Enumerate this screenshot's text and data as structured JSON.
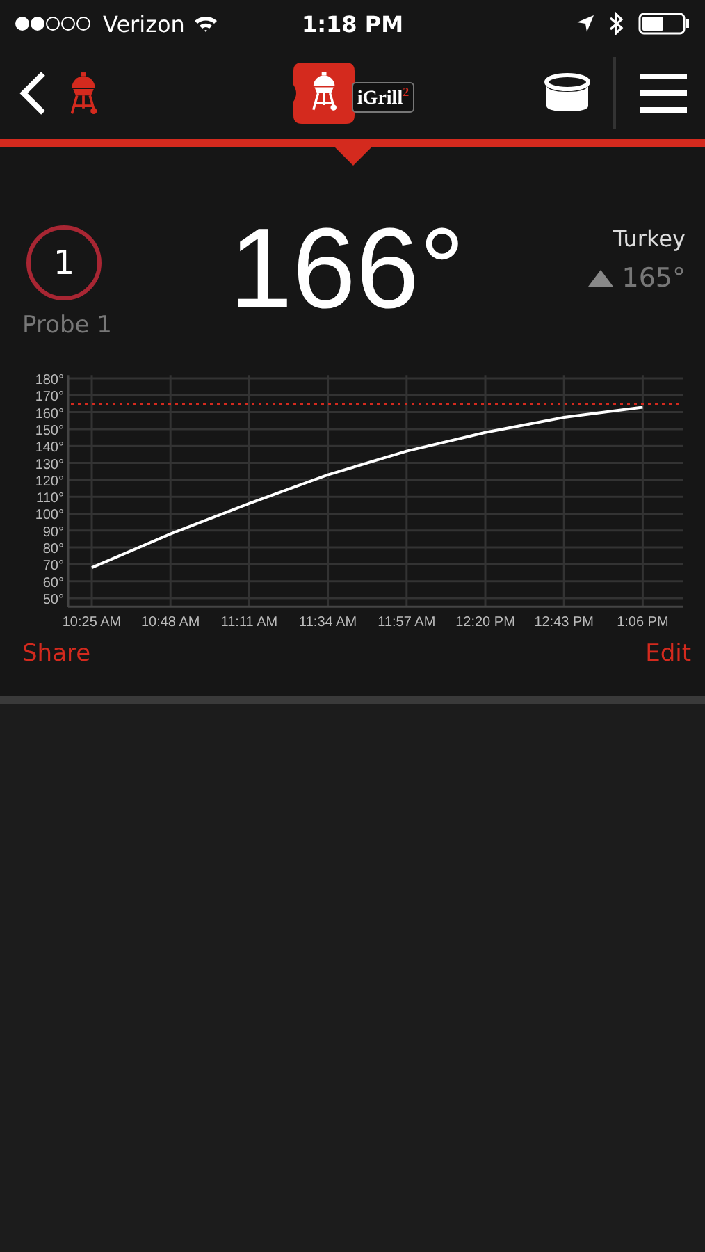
{
  "status_bar": {
    "carrier": "Verizon",
    "time": "1:18 PM"
  },
  "nav": {
    "logo_text": "iGrill$^{2}$"
  },
  "probe": {
    "number": "1",
    "label": "Probe 1",
    "temperature": "166°",
    "preset": "Turkey",
    "target": "165°",
    "chart_data": {
      "type": "line",
      "ylim": [
        45,
        182
      ],
      "grid": true,
      "categories": [
        "10:25 AM",
        "10:48 AM",
        "11:11 AM",
        "11:34 AM",
        "11:57 AM",
        "12:20 PM",
        "12:43 PM",
        "1:06 PM"
      ],
      "series": [
        {
          "color": "#ffffff",
          "values": [
            68,
            88,
            106,
            123,
            137,
            148,
            157,
            163
          ]
        }
      ],
      "yticks": [
        {
          "value": 180,
          "label": "180°"
        },
        {
          "value": 170,
          "label": "170°"
        },
        {
          "value": 160,
          "label": "160°"
        },
        {
          "value": 150,
          "label": "150°"
        },
        {
          "value": 140,
          "label": "140°"
        },
        {
          "value": 130,
          "label": "130°"
        },
        {
          "value": 120,
          "label": "120°"
        },
        {
          "value": 110,
          "label": "110°"
        },
        {
          "value": 100,
          "label": "100°"
        },
        {
          "value": 90,
          "label": "90°"
        },
        {
          "value": 80,
          "label": "80°"
        },
        {
          "value": 70,
          "label": "70°"
        },
        {
          "value": 60,
          "label": "60°"
        },
        {
          "value": 50,
          "label": "50°"
        }
      ],
      "ref_lines": [
        {
          "axis": "y",
          "value": 165
        }
      ]
    }
  },
  "actions": [
    {
      "label": "Share"
    },
    {
      "label": "Edit"
    }
  ]
}
